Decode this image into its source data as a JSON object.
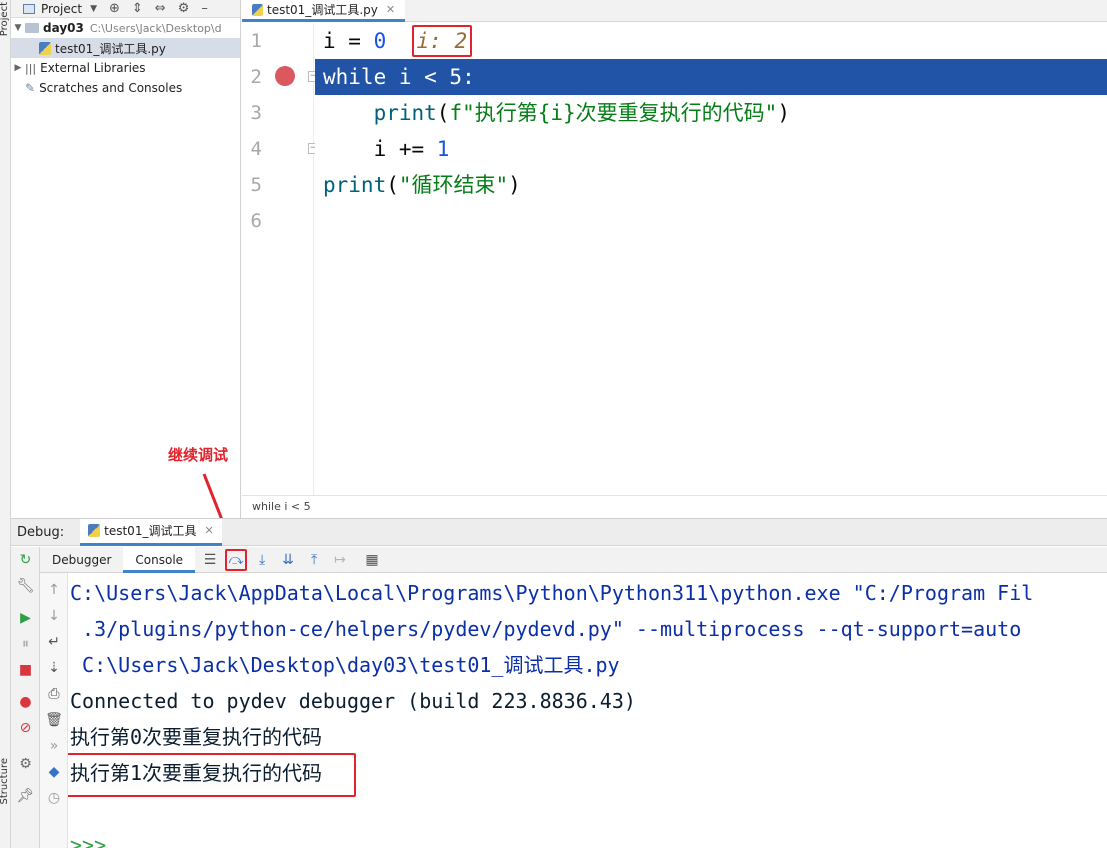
{
  "sidebars": {
    "project_label": "Project",
    "structure_label": "Structure"
  },
  "project_panel": {
    "title": "Project",
    "tree": [
      {
        "label": "day03",
        "hint": "C:\\Users\\Jack\\Desktop\\d"
      },
      {
        "label": "test01_调试工具.py"
      },
      {
        "label": "External Libraries"
      },
      {
        "label": "Scratches and Consoles"
      }
    ]
  },
  "editor": {
    "tab_label": "test01_调试工具.py",
    "line_numbers": [
      "1",
      "2",
      "3",
      "4",
      "5",
      "6"
    ],
    "code": {
      "l1_var": "i = ",
      "l1_num": "0",
      "l1_inline": "i: 2",
      "l2": "while i < 5:",
      "l3_fn": "print",
      "l3_open": "(",
      "l3_str": "f\"执行第{i}次要重复执行的代码\"",
      "l3_close": ")",
      "l4_var": "i += ",
      "l4_num": "1",
      "l5_fn": "print",
      "l5_open": "(",
      "l5_str": "\"循环结束\"",
      "l5_close": ")"
    },
    "breadcrumb": "while i < 5"
  },
  "annotation": {
    "label": "继续调试"
  },
  "debug": {
    "title": "Debug:",
    "session_tab": "test01_调试工具",
    "tabs": [
      "Debugger",
      "Console"
    ],
    "console_lines": [
      "C:\\Users\\Jack\\AppData\\Local\\Programs\\Python\\Python311\\python.exe \"C:/Program Fil",
      " .3/plugins/python-ce/helpers/pydev/pydevd.py\" --multiprocess --qt-support=auto",
      " C:\\Users\\Jack\\Desktop\\day03\\test01_调试工具.py",
      "Connected to pydev debugger (build 223.8836.43)",
      "执行第0次要重复执行的代码",
      "执行第1次要重复执行的代码",
      ">>>"
    ]
  },
  "colors": {
    "execution_line": "#2154a6",
    "breakpoint": "#db5860",
    "annotation_red": "#e0232c",
    "string_green": "#067d17",
    "number_blue": "#1750eb"
  }
}
